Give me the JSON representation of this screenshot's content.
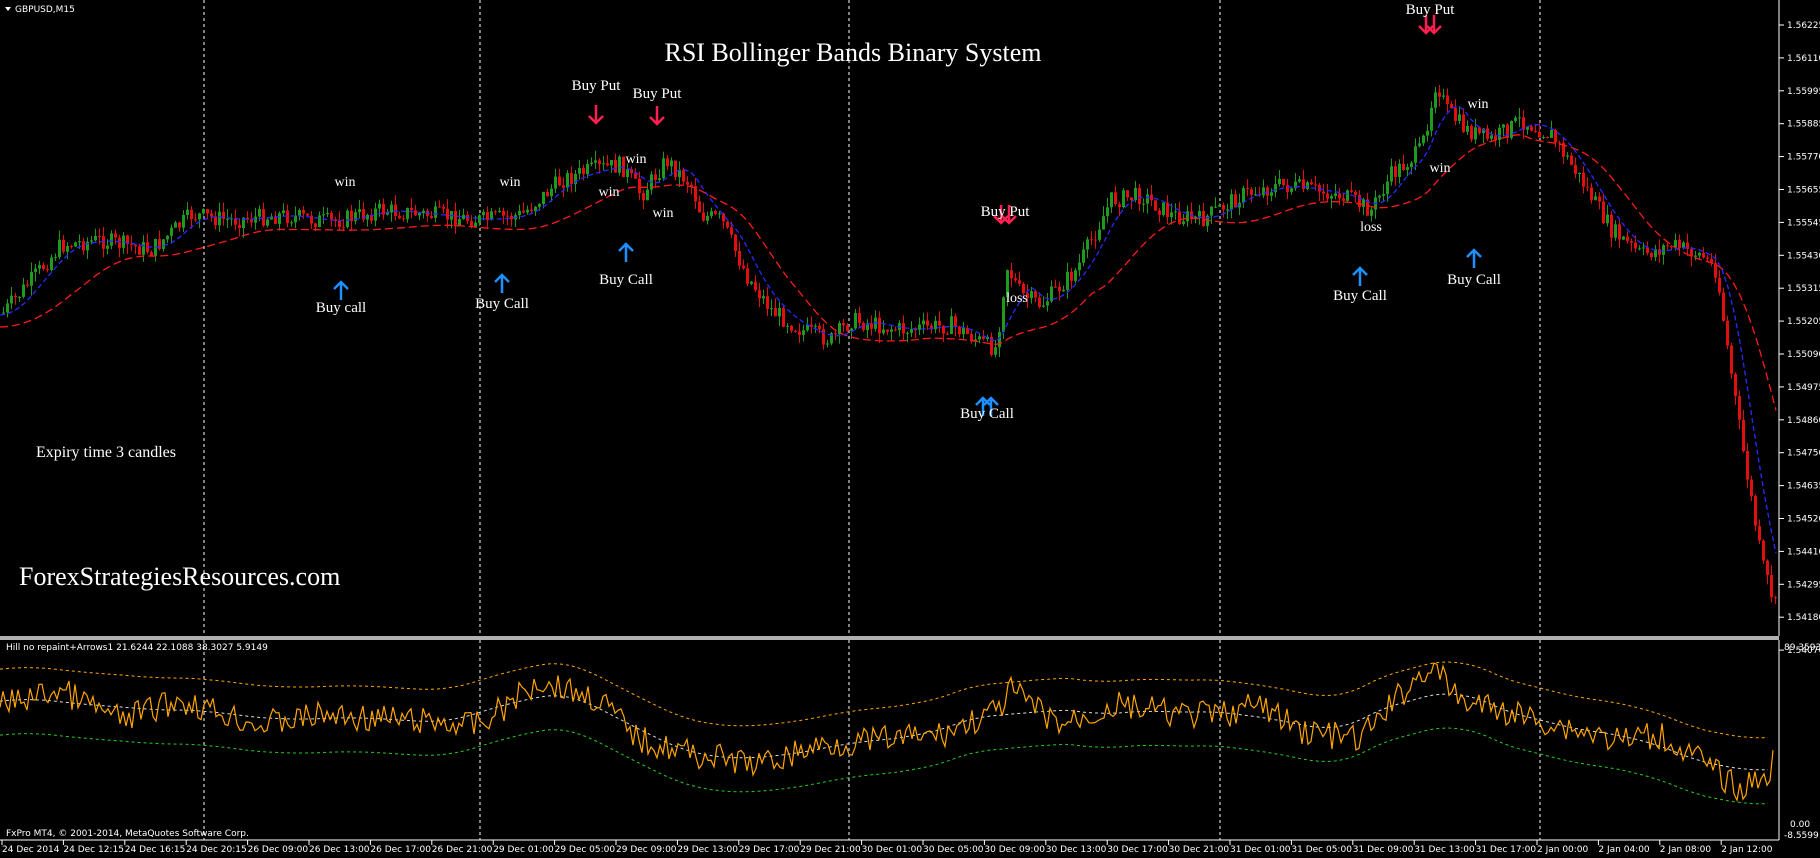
{
  "window": {
    "symbol_label": "GBPUSD,M15",
    "footer": "FxPro MT4, © 2001-2014, MetaQuotes Software Corp."
  },
  "main_chart": {
    "title": "RSI Bollinger Bands Binary System",
    "expiry_note": "Expiry time 3 candles",
    "watermark": "ForexStrategiesResources.com",
    "price_axis": [
      "1.56225",
      "1.56110",
      "1.55995",
      "1.55885",
      "1.55770",
      "1.55655",
      "1.55545",
      "1.55430",
      "1.55315",
      "1.55205",
      "1.55090",
      "1.54975",
      "1.54860",
      "1.54750",
      "1.54635",
      "1.54520",
      "1.54410",
      "1.54295",
      "1.54180",
      "1.54070"
    ],
    "price_range": [
      1.5401,
      1.5628
    ],
    "colors": {
      "bull": "#1e9b1e",
      "bear": "#e01010",
      "ma_fast": "#2a2aff",
      "ma_slow": "#ff1a1a",
      "grid": "#ffffff",
      "arrow_up": "#1e90ff",
      "arrow_down": "#ff2050"
    }
  },
  "signals": [
    {
      "type": "call",
      "label": "Buy call",
      "icon": "arrow-up-icon"
    },
    {
      "type": "call",
      "label": "Buy Call",
      "icon": "arrow-up-icon"
    },
    {
      "type": "put",
      "label": "Buy Put",
      "icon": "arrow-down-icon"
    },
    {
      "type": "put",
      "label": "Buy Put",
      "icon": "arrow-down-icon"
    },
    {
      "type": "call",
      "label": "Buy Call",
      "icon": "arrow-up-icon"
    },
    {
      "type": "call",
      "label": "Buy Call",
      "icon": "double-arrow-up-icon"
    },
    {
      "type": "put",
      "label": "Buy Put",
      "icon": "double-arrow-down-icon"
    },
    {
      "type": "call",
      "label": "Buy Call",
      "icon": "arrow-up-icon"
    },
    {
      "type": "put",
      "label": "Buy Put",
      "icon": "double-arrow-down-icon"
    },
    {
      "type": "call",
      "label": "Buy Call",
      "icon": "arrow-up-icon"
    }
  ],
  "results": [
    "win",
    "win",
    "win",
    "win",
    "win",
    "loss",
    "loss",
    "win",
    "win"
  ],
  "indicator": {
    "label": "Hill no repaint+Arrows1 21.6244 22.1088 38.3027 5.9149",
    "axis_top": "89.3593",
    "axis_mid": "0.00",
    "axis_bottom": "-8.5599",
    "colors": {
      "line": "#ffa500",
      "upper": "#ffa500",
      "mid": "#dddddd",
      "lower": "#22cc22"
    }
  },
  "time_axis": [
    "24 Dec 2014",
    "24 Dec 12:15",
    "24 Dec 16:15",
    "24 Dec 20:15",
    "26 Dec 09:00",
    "26 Dec 13:00",
    "26 Dec 17:00",
    "26 Dec 21:00",
    "29 Dec 01:00",
    "29 Dec 05:00",
    "29 Dec 09:00",
    "29 Dec 13:00",
    "29 Dec 17:00",
    "29 Dec 21:00",
    "30 Dec 01:00",
    "30 Dec 05:00",
    "30 Dec 09:00",
    "30 Dec 13:00",
    "30 Dec 17:00",
    "30 Dec 21:00",
    "31 Dec 01:00",
    "31 Dec 05:00",
    "31 Dec 09:00",
    "31 Dec 13:00",
    "31 Dec 17:00",
    "2 Jan 00:00",
    "2 Jan 04:00",
    "2 Jan 08:00",
    "2 Jan 12:00"
  ]
}
